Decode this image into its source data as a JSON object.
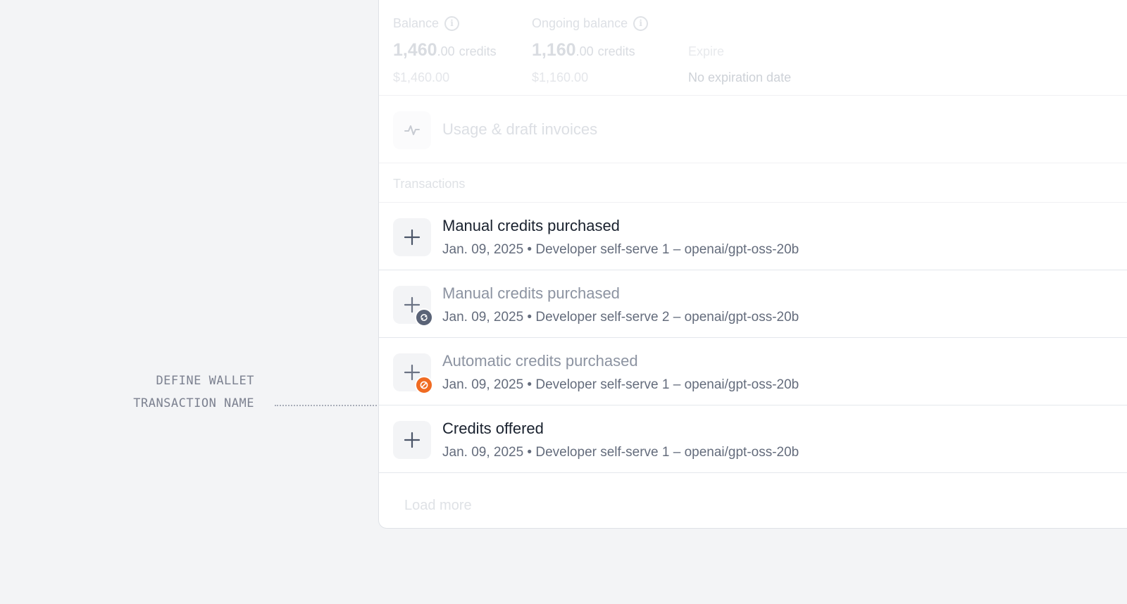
{
  "annotation": {
    "line1": "DEFINE WALLET",
    "line2": "TRANSACTION NAME"
  },
  "balance": {
    "label": "Balance",
    "value_main": "1,460",
    "value_decimal": ".00",
    "unit": "credits",
    "money": "$1,460.00"
  },
  "ongoing": {
    "label": "Ongoing balance",
    "value_main": "1,160",
    "value_decimal": ".00",
    "unit": "credits",
    "money": "$1,160.00"
  },
  "expire": {
    "label": "Expire",
    "value": "No expiration date"
  },
  "usage": {
    "label": "Usage & draft invoices",
    "icon": "activity-icon"
  },
  "transactions": {
    "header": "Transactions",
    "items": [
      {
        "title": "Manual credits purchased",
        "meta": "Jan. 09, 2025 • Developer self-serve 1 – openai/gpt-oss-20b",
        "icon": "plus-icon",
        "badge": null,
        "state": "active"
      },
      {
        "title": "Manual credits purchased",
        "meta": "Jan. 09, 2025 • Developer self-serve 2 – openai/gpt-oss-20b",
        "icon": "plus-icon",
        "badge": "sync-icon",
        "state": "muted"
      },
      {
        "title": "Automatic credits purchased",
        "meta": "Jan. 09, 2025 • Developer self-serve 1 – openai/gpt-oss-20b",
        "icon": "plus-icon",
        "badge": "blocked-icon",
        "state": "muted"
      },
      {
        "title": "Credits offered",
        "meta": "Jan. 09, 2025 • Developer self-serve 1 – openai/gpt-oss-20b",
        "icon": "plus-icon",
        "badge": null,
        "state": "active"
      }
    ],
    "load_more": "Load more"
  },
  "colors": {
    "page_background": "#f3f4f6",
    "card_background": "#ffffff",
    "title_active": "#19212e",
    "title_muted": "#8c93a1",
    "meta_text": "#646c7c",
    "badge_sync": "#5a6377",
    "badge_blocked": "#f06b22"
  }
}
